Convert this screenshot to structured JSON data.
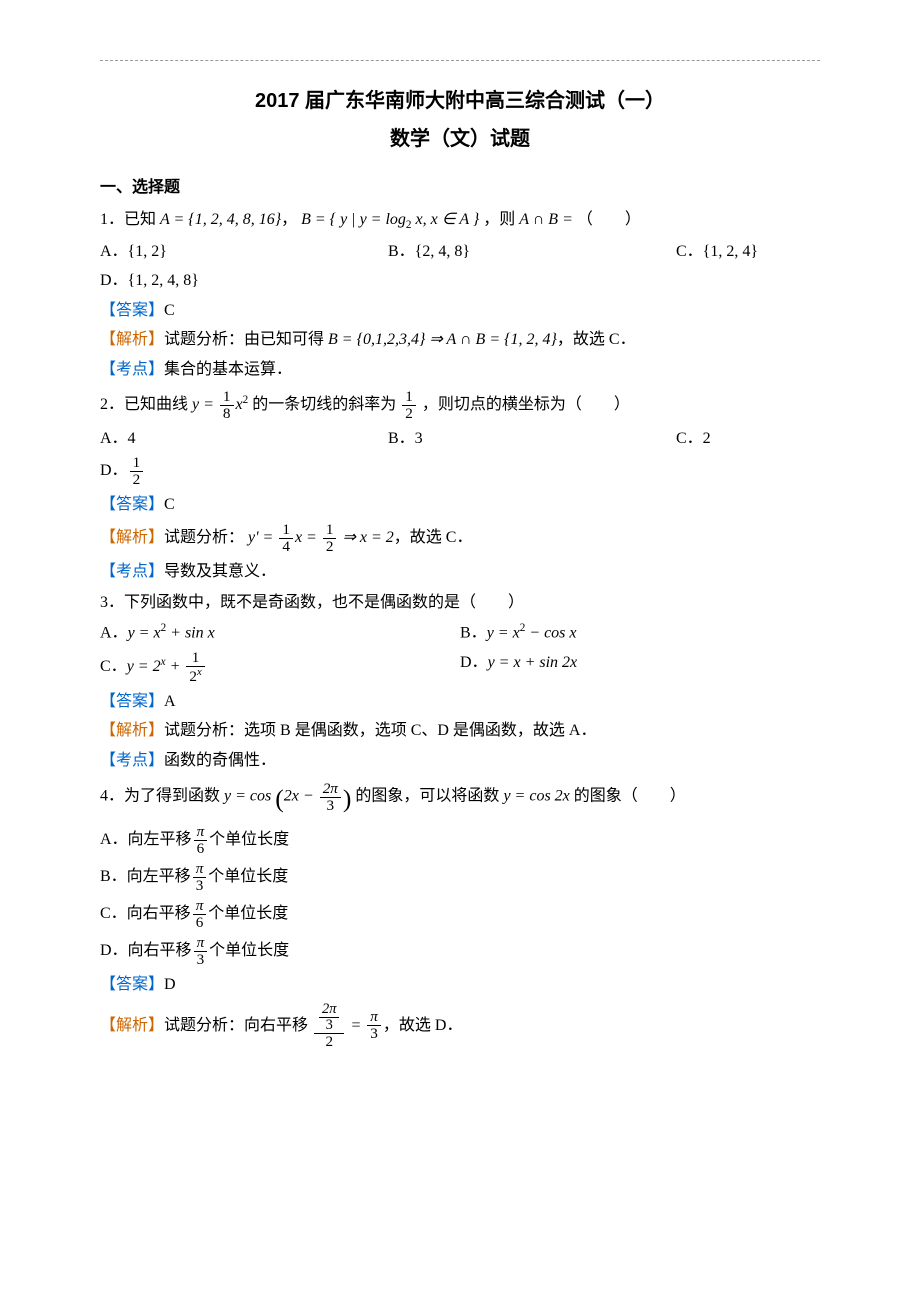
{
  "header": {
    "title1": "2017 届广东华南师大附中高三综合测试（一）",
    "title2": "数学（文）试题"
  },
  "section1_head": "一、选择题",
  "q1": {
    "stem_pre": "1．已知",
    "setA": "A = {1, 2, 4, 8, 16}",
    "mid1": "，",
    "setB": "B = { y | y = log",
    "setB_sub": "2",
    "setB_tail": " x, x ∈ A }",
    "mid2": "，则",
    "expr": "A ∩ B =",
    "blank": "（　　）",
    "optA": "A．{1, 2}",
    "optB": "B．{2, 4, 8}",
    "optC": "C．{1, 2, 4}",
    "optD": "D．{1, 2, 4, 8}",
    "ans_tag": "【答案】",
    "ans_val": "C",
    "exp_tag": "【解析】",
    "exp_pre": "试题分析：由已知可得",
    "exp_B": "B = {0,1,2,3,4} ⇒ A ∩ B = {1, 2, 4}",
    "exp_tail": "，故选 C．",
    "kp_tag": "【考点】",
    "kp_txt": "集合的基本运算．"
  },
  "q2": {
    "stem_pre": "2．已知曲线",
    "y_eq": "y =",
    "frac1_num": "1",
    "frac1_den": "8",
    "x2": "x",
    "sup2": "2",
    "mid1": "的一条切线的斜率为",
    "frac2_num": "1",
    "frac2_den": "2",
    "mid2": "，则切点的横坐标为（　　）",
    "optA": "A．4",
    "optB": "B．3",
    "optC": "C．2",
    "optD_pre": "D．",
    "optD_num": "1",
    "optD_den": "2",
    "ans_tag": "【答案】",
    "ans_val": "C",
    "exp_tag": "【解析】",
    "exp_pre": "试题分析：",
    "exp_yprime": "y' =",
    "exp_f1n": "1",
    "exp_f1d": "4",
    "exp_x_eq": "x =",
    "exp_f2n": "1",
    "exp_f2d": "2",
    "exp_arrow": "⇒ x = 2",
    "exp_tail": "，故选 C．",
    "kp_tag": "【考点】",
    "kp_txt": "导数及其意义．"
  },
  "q3": {
    "stem": "3．下列函数中，既不是奇函数，也不是偶函数的是（　　）",
    "optA_pre": "A．",
    "optA_math": "y = x",
    "optA_sup": "2",
    "optA_tail": " + sin x",
    "optB_pre": "B．",
    "optB_math": "y = x",
    "optB_sup": "2",
    "optB_tail": " − cos x",
    "optC_pre": "C．",
    "optC_y": "y = 2",
    "optC_supx": "x",
    "optC_plus": " + ",
    "optC_num": "1",
    "optC_den_2": "2",
    "optC_den_x": "x",
    "optD_pre": "D．",
    "optD_math": "y = x + sin 2x",
    "ans_tag": "【答案】",
    "ans_val": "A",
    "exp_tag": "【解析】",
    "exp_txt": "试题分析：选项 B 是偶函数，选项 C、D 是偶函数，故选 A．",
    "kp_tag": "【考点】",
    "kp_txt": "函数的奇偶性．"
  },
  "q4": {
    "stem_pre": "4．为了得到函数",
    "y_eq": "y = cos",
    "inner_pre": "2x −",
    "inner_num": "2π",
    "inner_den": "3",
    "mid": "的图象，可以将函数",
    "y2": "y = cos 2x",
    "tail": "的图象（　　）",
    "optA_pre": "A．向左平移",
    "optA_num": "π",
    "optA_den": "6",
    "optA_tail": "个单位长度",
    "optB_pre": "B．向左平移",
    "optB_num": "π",
    "optB_den": "3",
    "optB_tail": "个单位长度",
    "optC_pre": "C．向右平移",
    "optC_num": "π",
    "optC_den": "6",
    "optC_tail": "个单位长度",
    "optD_pre": "D．向右平移",
    "optD_num": "π",
    "optD_den": "3",
    "optD_tail": "个单位长度",
    "ans_tag": "【答案】",
    "ans_val": "D",
    "exp_tag": "【解析】",
    "exp_pre": "试题分析：向右平移",
    "exp_bignum_top": "2π",
    "exp_bignum_bot": "3",
    "exp_bigden": "2",
    "exp_eq": "=",
    "exp_rnum": "π",
    "exp_rden": "3",
    "exp_tail": "，故选 D．"
  }
}
